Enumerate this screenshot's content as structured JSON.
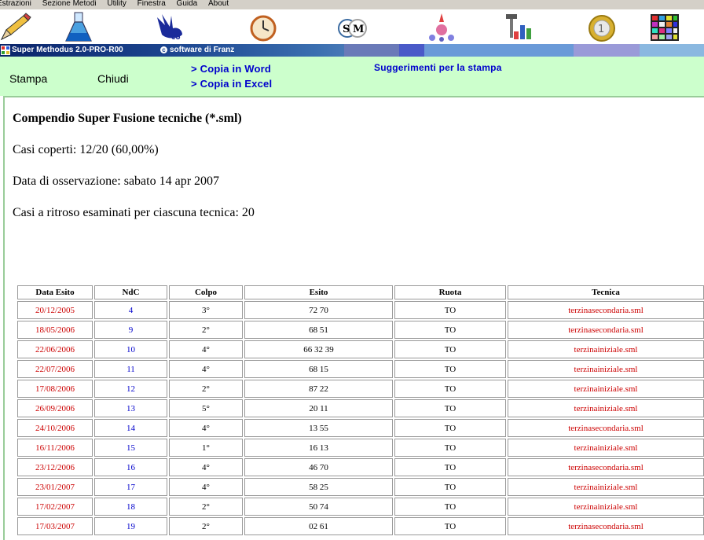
{
  "menu": [
    "Estrazioni",
    "Sezione Metodi",
    "Utility",
    "Finestra",
    "Guida",
    "About"
  ],
  "toolbar_icons": [
    "pencil-icon",
    "flask-icon",
    "bird-logo-icon",
    "clock-icon",
    "sm-logo-icon",
    "molecule-icon",
    "tools-icon",
    "euro-coin-icon",
    "color-grid-icon"
  ],
  "titlebar": {
    "title": "Super Methodus 2.0-PRO-R00",
    "credit": "software di Franz",
    "copyright_symbol": "c"
  },
  "actions": {
    "stampa": "Stampa",
    "chiudi": "Chiudi",
    "copia_word": "> Copia in Word",
    "copia_excel": "> Copia in Excel",
    "suggerimenti": "Suggerimenti per la stampa"
  },
  "report": {
    "title": "Compendio Super Fusione tecniche (*.sml)",
    "casi_coperti": "Casi coperti: 12/20 (60,00%)",
    "data_osservazione": "Data di osservazione: sabato 14 apr 2007",
    "casi_esaminati": "Casi a ritroso esaminati per ciascuna tecnica: 20"
  },
  "table": {
    "headers": [
      "Data Esito",
      "NdC",
      "Colpo",
      "Esito",
      "Ruota",
      "Tecnica"
    ],
    "rows": [
      [
        "20/12/2005",
        "4",
        "3°",
        "72 70",
        "TO",
        "terzinasecondaria.sml"
      ],
      [
        "18/05/2006",
        "9",
        "2°",
        "68 51",
        "TO",
        "terzinasecondaria.sml"
      ],
      [
        "22/06/2006",
        "10",
        "4°",
        "66 32 39",
        "TO",
        "terzinainiziale.sml"
      ],
      [
        "22/07/2006",
        "11",
        "4°",
        "68 15",
        "TO",
        "terzinainiziale.sml"
      ],
      [
        "17/08/2006",
        "12",
        "2°",
        "87 22",
        "TO",
        "terzinainiziale.sml"
      ],
      [
        "26/09/2006",
        "13",
        "5°",
        "20 11",
        "TO",
        "terzinainiziale.sml"
      ],
      [
        "24/10/2006",
        "14",
        "4°",
        "13 55",
        "TO",
        "terzinasecondaria.sml"
      ],
      [
        "16/11/2006",
        "15",
        "1°",
        "16 13",
        "TO",
        "terzinainiziale.sml"
      ],
      [
        "23/12/2006",
        "16",
        "4°",
        "46 70",
        "TO",
        "terzinasecondaria.sml"
      ],
      [
        "23/01/2007",
        "17",
        "4°",
        "58 25",
        "TO",
        "terzinainiziale.sml"
      ],
      [
        "17/02/2007",
        "18",
        "2°",
        "50 74",
        "TO",
        "terzinainiziale.sml"
      ],
      [
        "17/03/2007",
        "19",
        "2°",
        "02 61",
        "TO",
        "terzinasecondaria.sml"
      ]
    ]
  },
  "colors": {
    "action_bar": "#ccffcc",
    "link": "#0000cc",
    "date": "#cc0000",
    "titlebar": "#0a246a"
  }
}
